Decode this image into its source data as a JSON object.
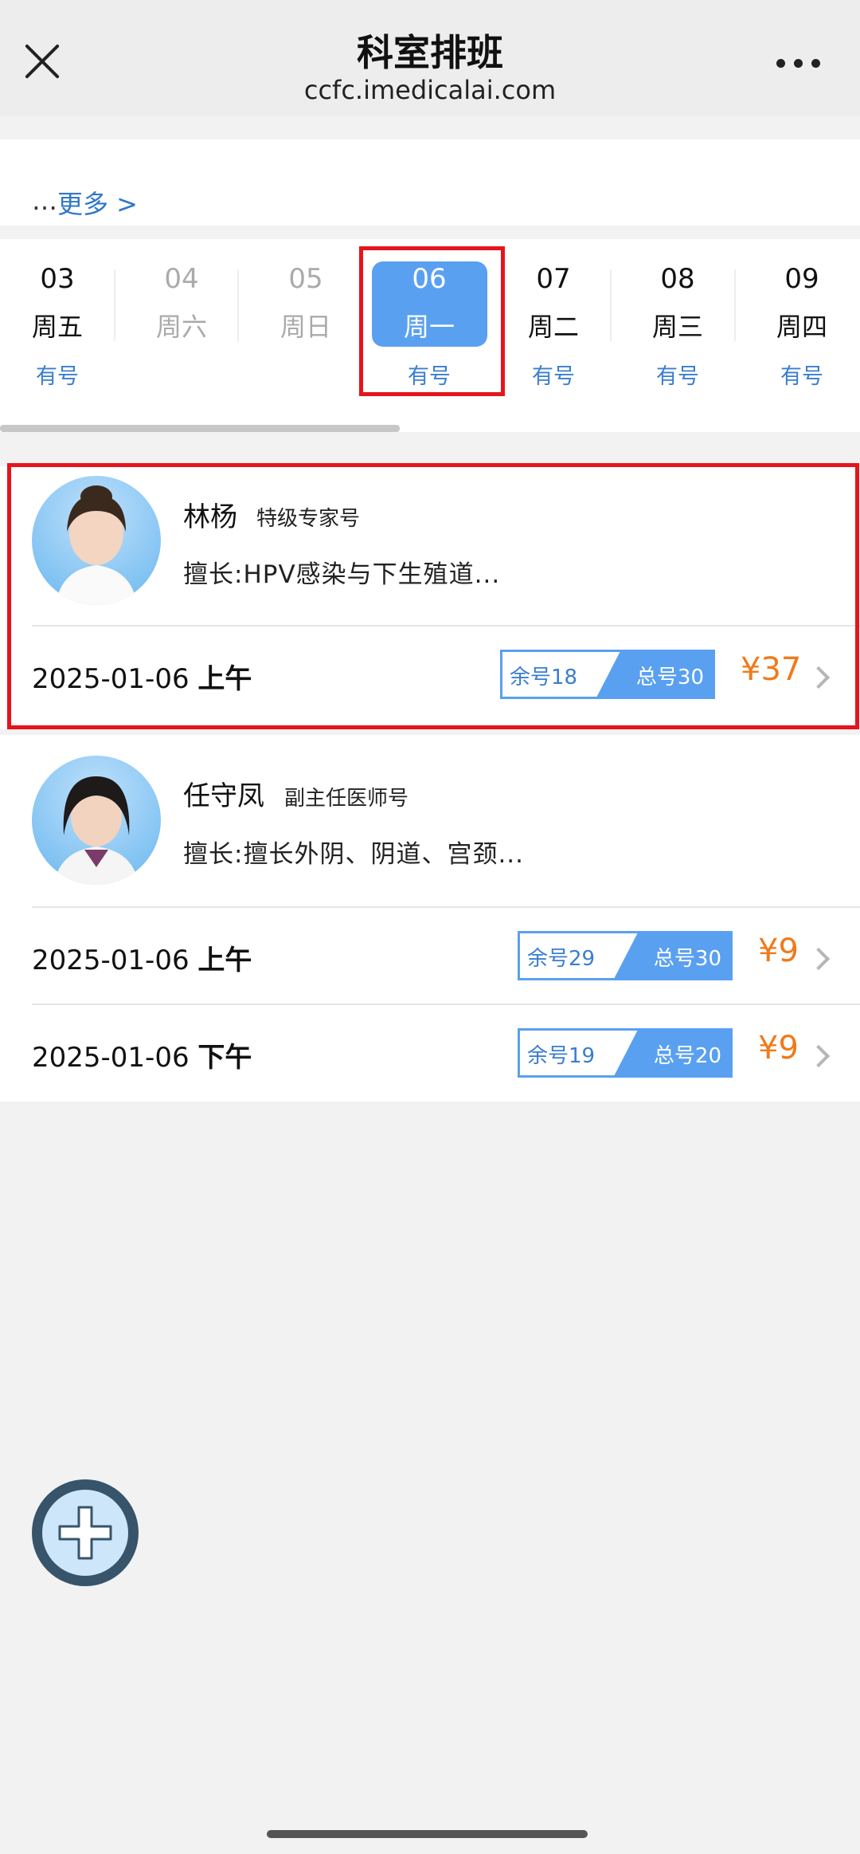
{
  "nav": {
    "title": "科室排班",
    "url": "ccfc.imedicalai.com"
  },
  "more": {
    "dots": "…",
    "link": "更多 >"
  },
  "dates": [
    {
      "day": "03",
      "weekday": "周五",
      "status": "有号"
    },
    {
      "day": "04",
      "weekday": "周六",
      "status": ""
    },
    {
      "day": "05",
      "weekday": "周日",
      "status": ""
    },
    {
      "day": "06",
      "weekday": "周一",
      "status": "有号"
    },
    {
      "day": "07",
      "weekday": "周二",
      "status": "有号"
    },
    {
      "day": "08",
      "weekday": "周三",
      "status": "有号"
    },
    {
      "day": "09",
      "weekday": "周四",
      "status": "有号"
    }
  ],
  "doctors": [
    {
      "name": "林杨",
      "title": "特级专家号",
      "specialty": "擅长:HPV感染与下生殖道...",
      "slots": [
        {
          "date": "2025-01-06",
          "period": "上午",
          "remaining": "余号18",
          "total": "总号30",
          "price": "¥37"
        }
      ]
    },
    {
      "name": "任守凤",
      "title": "副主任医师号",
      "specialty": "擅长:擅长外阴、阴道、宫颈...",
      "slots": [
        {
          "date": "2025-01-06",
          "period": "上午",
          "remaining": "余号29",
          "total": "总号30",
          "price": "¥9"
        },
        {
          "date": "2025-01-06",
          "period": "下午",
          "remaining": "余号19",
          "total": "总号20",
          "price": "¥9"
        }
      ]
    }
  ],
  "colors": {
    "accent": "#5aa0f0",
    "link": "#3a7ecf",
    "price": "#f07a1a",
    "highlight": "#e6141c"
  },
  "icons": {
    "close": "close-icon",
    "more": "more-icon",
    "add": "add-icon",
    "chevron": "chevron-right-icon"
  }
}
